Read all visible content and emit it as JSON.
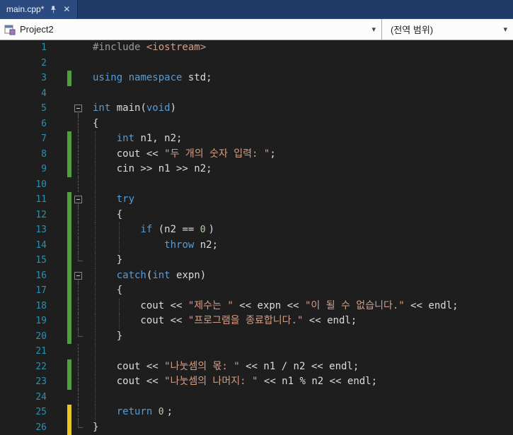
{
  "tab": {
    "title": "main.cpp*",
    "close_glyph": "✕"
  },
  "navbar": {
    "project": "Project2",
    "scope": "(전역 범위)",
    "arrow_glyph": "▾"
  },
  "colors": {
    "tabbar_bg": "#1f3a66",
    "active_tab_bg": "#2a4a80",
    "navbar_bg": "#f8f8f8",
    "editor_bg": "#1e1e1e",
    "line_number": "#2b91af",
    "keyword": "#569cd6",
    "string": "#d69d85",
    "preprocessor": "#9b9b9b",
    "number_literal": "#b5cea8",
    "plain_text": "#dcdcdc",
    "change_saved_green": "#4f9e3f",
    "change_unsaved_yellow": "#e8c71e"
  },
  "editor": {
    "lines": [
      {
        "n": 1,
        "tokens": [
          {
            "c": "pre",
            "t": "#include "
          },
          {
            "c": "str",
            "t": "<iostream>"
          }
        ]
      },
      {
        "n": 2,
        "tokens": []
      },
      {
        "n": 3,
        "change": "green",
        "tokens": [
          {
            "c": "kw",
            "t": "using"
          },
          {
            "c": "pln",
            "t": " "
          },
          {
            "c": "kw",
            "t": "namespace"
          },
          {
            "c": "pln",
            "t": " std;"
          }
        ]
      },
      {
        "n": 4,
        "tokens": []
      },
      {
        "n": 5,
        "fold": "box",
        "tokens": [
          {
            "c": "kw",
            "t": "int"
          },
          {
            "c": "pln",
            "t": " main("
          },
          {
            "c": "kw",
            "t": "void"
          },
          {
            "c": "pln",
            "t": ")"
          }
        ]
      },
      {
        "n": 6,
        "fold": "line",
        "tokens": [
          {
            "c": "pln",
            "t": "{"
          }
        ]
      },
      {
        "n": 7,
        "change": "green",
        "fold": "line",
        "guides": [
          0.4
        ],
        "tokens": [
          {
            "c": "pln",
            "t": "    "
          },
          {
            "c": "kw",
            "t": "int"
          },
          {
            "c": "pln",
            "t": " n1, n2;"
          }
        ]
      },
      {
        "n": 8,
        "change": "green",
        "fold": "line",
        "guides": [
          0.4
        ],
        "tokens": [
          {
            "c": "pln",
            "t": "    cout << "
          },
          {
            "c": "str",
            "t": "\"두 개의 숫자 입력: \""
          },
          {
            "c": "pln",
            "t": ";"
          }
        ]
      },
      {
        "n": 9,
        "change": "green",
        "fold": "line",
        "guides": [
          0.4
        ],
        "tokens": [
          {
            "c": "pln",
            "t": "    cin >> n1 >> n2;"
          }
        ]
      },
      {
        "n": 10,
        "fold": "line",
        "guides": [
          0.4
        ],
        "tokens": []
      },
      {
        "n": 11,
        "change": "green",
        "fold": "box",
        "guides": [
          0.4
        ],
        "tokens": [
          {
            "c": "pln",
            "t": "    "
          },
          {
            "c": "kw",
            "t": "try"
          }
        ]
      },
      {
        "n": 12,
        "change": "green",
        "fold": "line",
        "guides": [
          0.4
        ],
        "tokens": [
          {
            "c": "pln",
            "t": "    {"
          }
        ]
      },
      {
        "n": 13,
        "change": "green",
        "fold": "line",
        "guides": [
          0.4,
          4.4
        ],
        "tokens": [
          {
            "c": "pln",
            "t": "        "
          },
          {
            "c": "kw",
            "t": "if"
          },
          {
            "c": "pln",
            "t": " (n2 == "
          },
          {
            "c": "num",
            "t": "0"
          },
          {
            "c": "pln",
            "t": ")"
          }
        ]
      },
      {
        "n": 14,
        "change": "green",
        "fold": "line",
        "guides": [
          0.4,
          4.4
        ],
        "tokens": [
          {
            "c": "pln",
            "t": "            "
          },
          {
            "c": "kw",
            "t": "throw"
          },
          {
            "c": "pln",
            "t": " n2;"
          }
        ]
      },
      {
        "n": 15,
        "change": "green",
        "fold": "end",
        "guides": [
          0.4
        ],
        "tokens": [
          {
            "c": "pln",
            "t": "    }"
          }
        ]
      },
      {
        "n": 16,
        "change": "green",
        "fold": "box",
        "guides": [
          0.4
        ],
        "tokens": [
          {
            "c": "pln",
            "t": "    "
          },
          {
            "c": "kw",
            "t": "catch"
          },
          {
            "c": "pln",
            "t": "("
          },
          {
            "c": "kw",
            "t": "int"
          },
          {
            "c": "pln",
            "t": " expn)"
          }
        ]
      },
      {
        "n": 17,
        "change": "green",
        "fold": "line",
        "guides": [
          0.4
        ],
        "tokens": [
          {
            "c": "pln",
            "t": "    {"
          }
        ]
      },
      {
        "n": 18,
        "change": "green",
        "fold": "line",
        "guides": [
          0.4,
          4.4
        ],
        "tokens": [
          {
            "c": "pln",
            "t": "        cout << "
          },
          {
            "c": "str",
            "t": "\"제수는 \""
          },
          {
            "c": "pln",
            "t": " << expn << "
          },
          {
            "c": "str",
            "t": "\"이 될 수 없습니다.\""
          },
          {
            "c": "pln",
            "t": " << endl;"
          }
        ]
      },
      {
        "n": 19,
        "change": "green",
        "fold": "line",
        "guides": [
          0.4,
          4.4
        ],
        "tokens": [
          {
            "c": "pln",
            "t": "        cout << "
          },
          {
            "c": "str",
            "t": "\"프로그램을 종료합니다.\""
          },
          {
            "c": "pln",
            "t": " << endl;"
          }
        ]
      },
      {
        "n": 20,
        "change": "green",
        "fold": "end",
        "guides": [
          0.4
        ],
        "tokens": [
          {
            "c": "pln",
            "t": "    }"
          }
        ]
      },
      {
        "n": 21,
        "fold": "line",
        "guides": [
          0.4
        ],
        "tokens": []
      },
      {
        "n": 22,
        "change": "green",
        "fold": "line",
        "guides": [
          0.4
        ],
        "tokens": [
          {
            "c": "pln",
            "t": "    cout << "
          },
          {
            "c": "str",
            "t": "\"나눗셈의 몫: \""
          },
          {
            "c": "pln",
            "t": " << n1 / n2 << endl;"
          }
        ]
      },
      {
        "n": 23,
        "change": "green",
        "fold": "line",
        "guides": [
          0.4
        ],
        "tokens": [
          {
            "c": "pln",
            "t": "    cout << "
          },
          {
            "c": "str",
            "t": "\"나눗셈의 나머지: \""
          },
          {
            "c": "pln",
            "t": " << n1 % n2 << endl;"
          }
        ]
      },
      {
        "n": 24,
        "fold": "line",
        "guides": [
          0.4
        ],
        "tokens": []
      },
      {
        "n": 25,
        "change": "yellow",
        "fold": "line",
        "guides": [
          0.4
        ],
        "tokens": [
          {
            "c": "pln",
            "t": "    "
          },
          {
            "c": "kw",
            "t": "return"
          },
          {
            "c": "pln",
            "t": " "
          },
          {
            "c": "num",
            "t": "0"
          },
          {
            "c": "pln",
            "t": ";"
          }
        ]
      },
      {
        "n": 26,
        "change": "yellow",
        "fold": "end",
        "tokens": [
          {
            "c": "pln",
            "t": "}"
          }
        ]
      }
    ]
  }
}
